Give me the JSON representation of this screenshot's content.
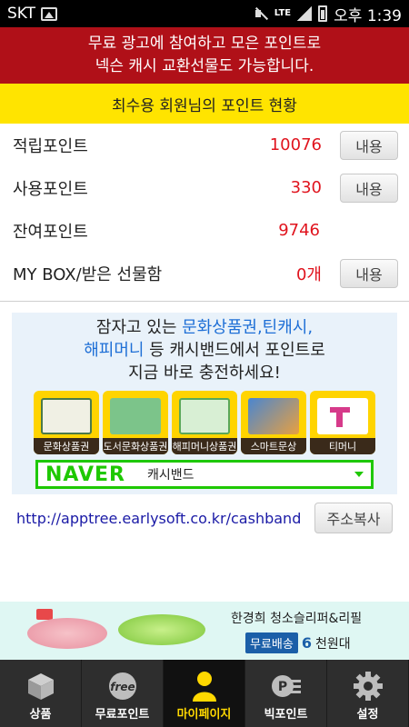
{
  "status_bar": {
    "carrier": "SKT",
    "network": "LTE",
    "time": "오후 1:39"
  },
  "banner": {
    "line1": "무료 광고에 참여하고 모은 포인트로",
    "line2": "넥슨 캐시 교환선물도 가능합니다."
  },
  "points_header": "최수용 회원님의 포인트 현황",
  "points": [
    {
      "label": "적립포인트",
      "value": "10076",
      "button": "내용"
    },
    {
      "label": "사용포인트",
      "value": "330",
      "button": "내용"
    },
    {
      "label": "잔여포인트",
      "value": "9746"
    },
    {
      "label": "MY BOX/받은 선물함",
      "value": "0개",
      "button": "내용"
    }
  ],
  "ad_card": {
    "line1_a": "잠자고 있는 ",
    "line1_b": "문화상품권,틴캐시,",
    "line2_a": "해피머니",
    "line2_b": " 등 캐시밴드에서 포인트로",
    "line3": "지금 바로 충전하세요!",
    "tiles": [
      {
        "caption": "문화상품권",
        "art_color": "#f0f0e4",
        "icon": "culture-voucher-icon"
      },
      {
        "caption": "도서문화상품권",
        "art_color": "#7cc48a",
        "icon": "book-voucher-icon"
      },
      {
        "caption": "해피머니상품권",
        "art_color": "#d8efd4",
        "icon": "happymoney-voucher-icon"
      },
      {
        "caption": "스마트문상",
        "art_color": "#4a86d0",
        "icon": "smart-voucher-icon"
      },
      {
        "caption": "티머니",
        "art_color": "#ffffff",
        "icon": "tmoney-icon"
      }
    ],
    "naver_logo": "NAVER",
    "naver_query": "캐시밴드"
  },
  "url": {
    "text": "http://apptree.earlysoft.co.kr/cashband",
    "copy_button": "주소복사"
  },
  "bottom_ad": {
    "title": "한경희 청소슬리퍼&리필",
    "badge": "무료배송",
    "price_num": "6",
    "price_unit": "천원대"
  },
  "nav": [
    {
      "label": "상품",
      "icon": "product-box-icon"
    },
    {
      "label": "무료포인트",
      "icon": "free-point-icon"
    },
    {
      "label": "마이페이지",
      "icon": "person-icon",
      "active": true
    },
    {
      "label": "빅포인트",
      "icon": "big-point-icon"
    },
    {
      "label": "설정",
      "icon": "gear-icon"
    }
  ],
  "colors": {
    "banner_red": "#b01018",
    "header_yellow": "#ffe400",
    "value_red": "#e0141e",
    "naver_green": "#1ec800",
    "nav_active": "#ffd800"
  }
}
